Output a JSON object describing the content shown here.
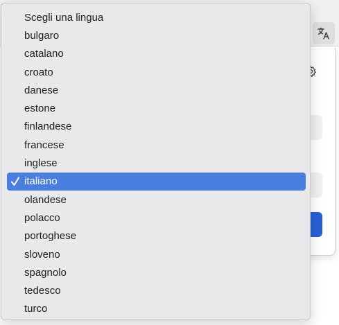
{
  "translate_button": {
    "icon": "translate-icon"
  },
  "panel": {
    "icon": "gear-icon",
    "accent": "#2b5fd4"
  },
  "menu": {
    "selected_index": 9,
    "selected_color": "#4a7fe0",
    "items": [
      {
        "label": "Scegli una lingua",
        "checked": false
      },
      {
        "label": "bulgaro",
        "checked": false
      },
      {
        "label": "catalano",
        "checked": false
      },
      {
        "label": "croato",
        "checked": false
      },
      {
        "label": "danese",
        "checked": false
      },
      {
        "label": "estone",
        "checked": false
      },
      {
        "label": "finlandese",
        "checked": false
      },
      {
        "label": "francese",
        "checked": false
      },
      {
        "label": "inglese",
        "checked": false
      },
      {
        "label": "italiano",
        "checked": true
      },
      {
        "label": "olandese",
        "checked": false
      },
      {
        "label": "polacco",
        "checked": false
      },
      {
        "label": "portoghese",
        "checked": false
      },
      {
        "label": "sloveno",
        "checked": false
      },
      {
        "label": "spagnolo",
        "checked": false
      },
      {
        "label": "tedesco",
        "checked": false
      },
      {
        "label": "turco",
        "checked": false
      }
    ]
  }
}
